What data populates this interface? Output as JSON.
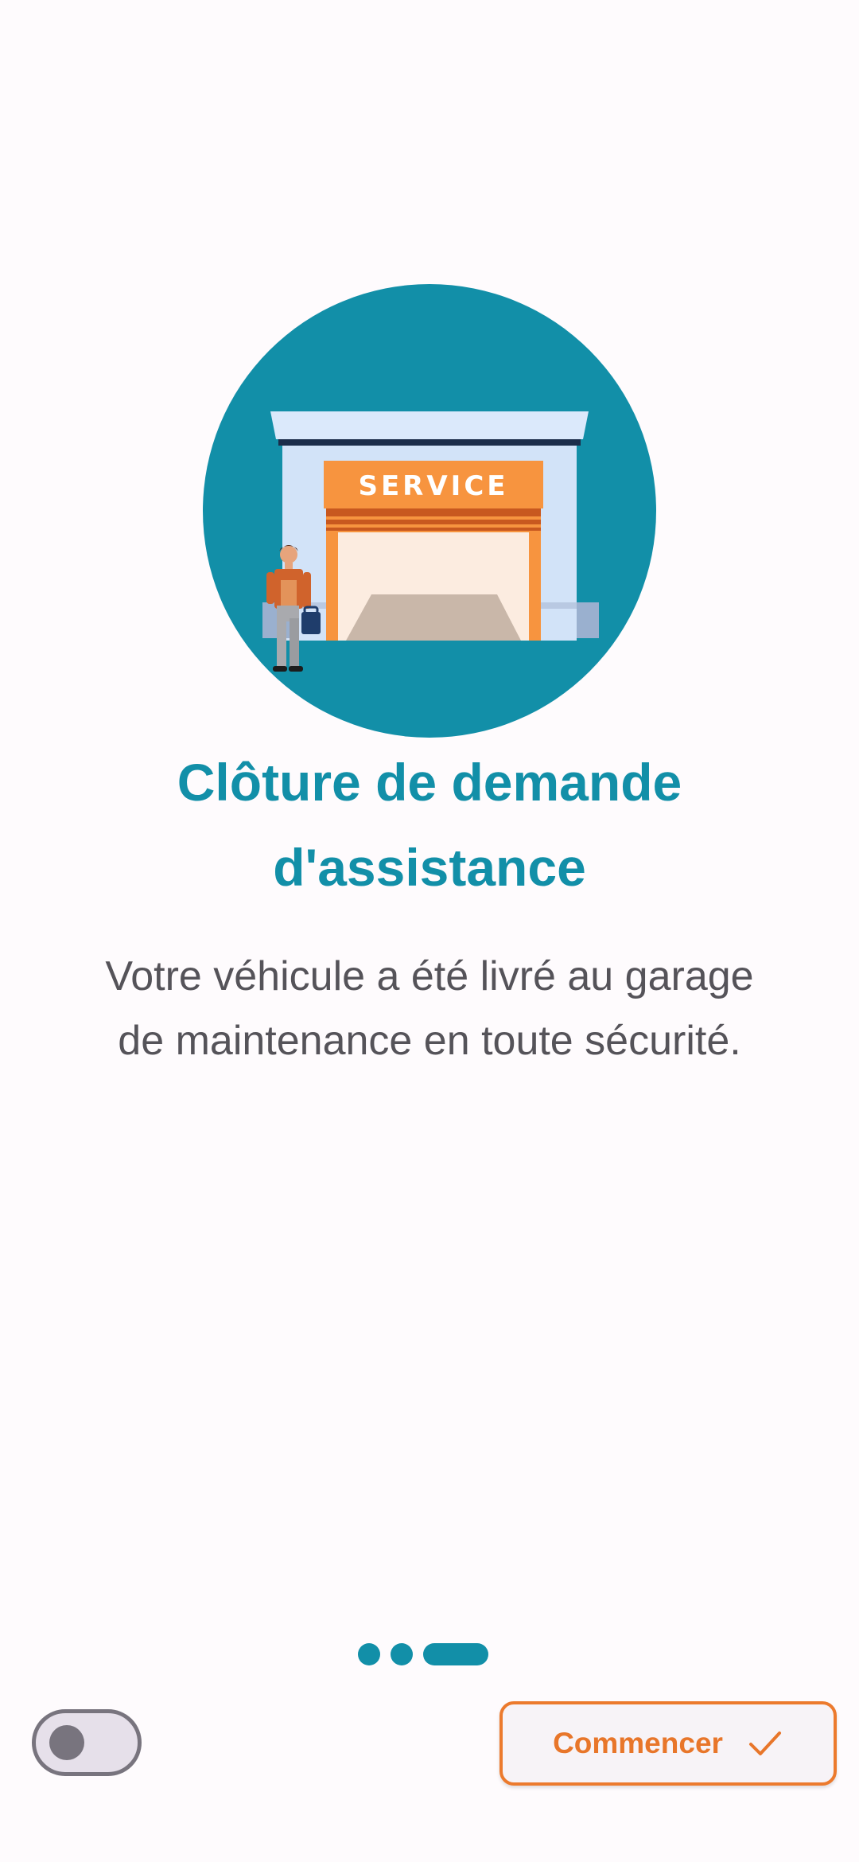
{
  "onboarding": {
    "illustration": {
      "sign_text": "SERVICE",
      "circle_color": "#128fa8",
      "sign_color": "#f7943f"
    },
    "title_line1": "Clôture de demande",
    "title_line2": "d'assistance",
    "description_line1": "Votre véhicule a été livré au garage",
    "description_line2": "de maintenance en toute sécurité.",
    "page_indicator": {
      "total": 3,
      "current": 3
    }
  },
  "footer": {
    "toggle_on": false,
    "start_label": "Commencer",
    "start_icon": "check-icon"
  },
  "colors": {
    "primary": "#128fa8",
    "accent": "#e8762a",
    "text": "#555359",
    "background": "#fefbfd"
  }
}
